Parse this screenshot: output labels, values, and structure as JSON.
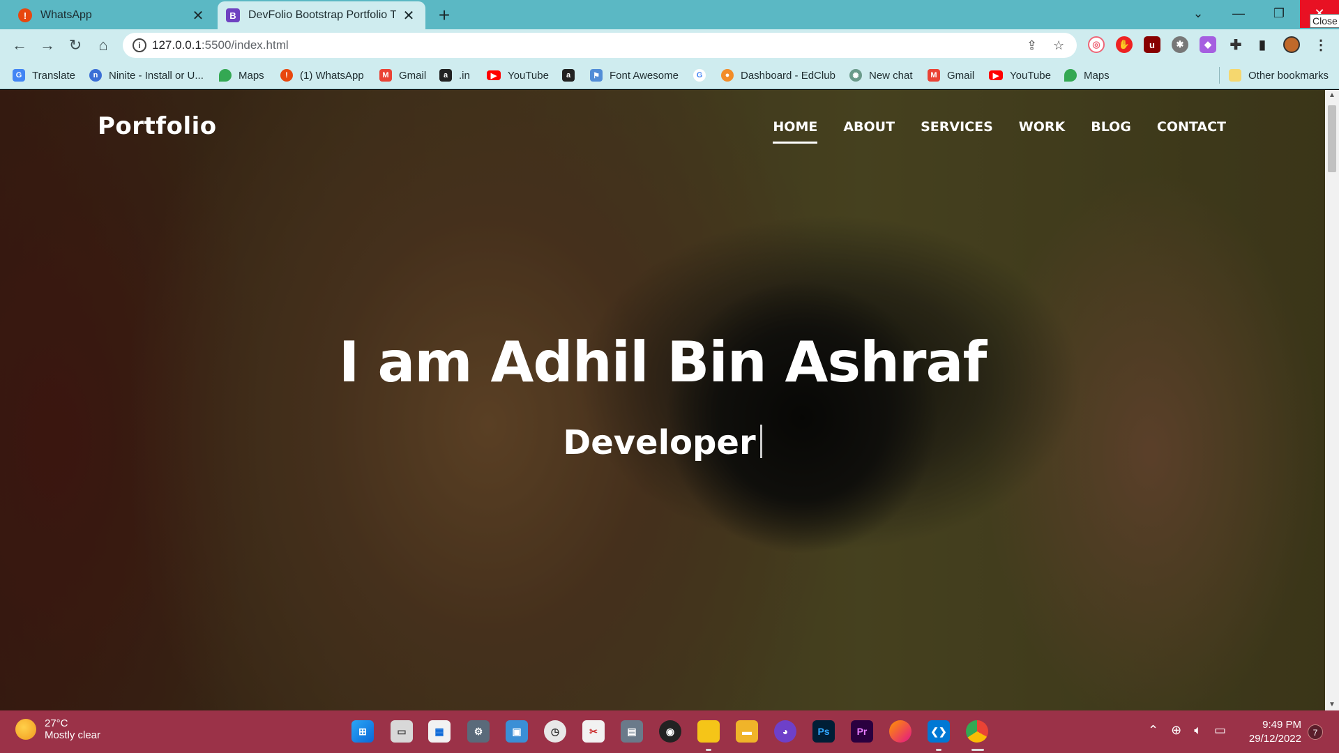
{
  "browser": {
    "tabs": [
      {
        "title": "WhatsApp",
        "icon": "whatsapp-alert-icon",
        "active": false
      },
      {
        "title": "DevFolio Bootstrap Portfolio Tem",
        "icon": "bootstrap-icon",
        "active": true
      }
    ],
    "close_tooltip": "Close",
    "url_host": "127.0.0.1",
    "url_rest": ":5500/index.html",
    "bookmarks": [
      {
        "label": "Translate",
        "icon": "translate-icon",
        "color": "#4285f4"
      },
      {
        "label": "Ninite - Install or U...",
        "icon": "ninite-icon",
        "color": "#3b6fd6"
      },
      {
        "label": "Maps",
        "icon": "maps-icon",
        "color": "#34a853"
      },
      {
        "label": "(1) WhatsApp",
        "icon": "whatsapp-alert-icon",
        "color": "#e8470e"
      },
      {
        "label": "Gmail",
        "icon": "gmail-icon",
        "color": "#ea4335"
      },
      {
        "label": ".in",
        "icon": "amazon-icon",
        "color": "#222222"
      },
      {
        "label": "YouTube",
        "icon": "youtube-icon",
        "color": "#ff0000"
      },
      {
        "label": "",
        "icon": "amazon-icon",
        "color": "#222222"
      },
      {
        "label": "Font Awesome",
        "icon": "flag-icon",
        "color": "#528dd7"
      },
      {
        "label": "",
        "icon": "google-icon",
        "color": "#ffffff"
      },
      {
        "label": "Dashboard - EdClub",
        "icon": "edclub-icon",
        "color": "#f28c28"
      },
      {
        "label": "New chat",
        "icon": "openai-icon",
        "color": "#6a9a8a"
      },
      {
        "label": "Gmail",
        "icon": "gmail-icon",
        "color": "#ea4335"
      },
      {
        "label": "YouTube",
        "icon": "youtube-icon",
        "color": "#ff0000"
      },
      {
        "label": "Maps",
        "icon": "maps-icon",
        "color": "#34a853"
      }
    ],
    "other_bookmarks": "Other bookmarks"
  },
  "page": {
    "brand": "Portfolio",
    "nav": [
      "HOME",
      "ABOUT",
      "SERVICES",
      "WORK",
      "BLOG",
      "CONTACT"
    ],
    "active_nav": "HOME",
    "hero_title": "I am Adhil Bin Ashraf",
    "hero_subtitle": "Developer"
  },
  "taskbar": {
    "weather_temp": "27°C",
    "weather_desc": "Mostly clear",
    "apps": [
      "windows-start-icon",
      "task-view-icon",
      "store-icon",
      "settings-icon",
      "remote-desktop-icon",
      "clock-icon",
      "snipping-tool-icon",
      "calculator-icon",
      "obs-icon",
      "sticky-notes-icon",
      "file-explorer-icon",
      "github-desktop-icon",
      "photoshop-icon",
      "premiere-pro-icon",
      "firefox-icon",
      "vscode-icon",
      "chrome-icon"
    ],
    "time": "9:49 PM",
    "date": "29/12/2022",
    "notifications": "7"
  }
}
